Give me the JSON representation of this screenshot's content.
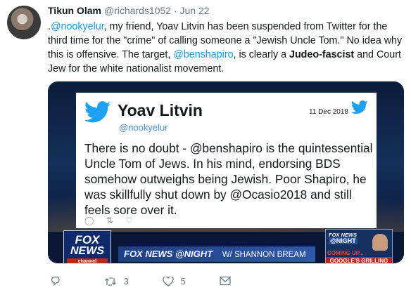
{
  "tweet": {
    "author_name": "Tikun Olam",
    "handle": "@richards1052",
    "separator": "·",
    "date": "Jun 22",
    "text_parts": [
      ".",
      "@nookyelur",
      ", my friend, Yoav Litvin has been suspended from Twitter for the third time for the \"crime\" of calling someone a \"Jewish Uncle Tom.\"  No idea why this is offensive. The target, ",
      "@benshapiro",
      ", is clearly a ",
      "Judeo-fascist",
      " and Court Jew for the white nationalist movement."
    ]
  },
  "quoted": {
    "name": "Yoav Litvin",
    "handle": "@nookyelur",
    "date": "11 Dec 2018",
    "text": "There is no doubt - @benshapiro is the quintessential Uncle Tom of Jews. In his mind, endorsing BDS somehow outweighs being Jewish. Poor Shapiro, he was skillfully shut down by @Ocasio2018 and still feels sore over it."
  },
  "fox": {
    "logo_line1": "FOX",
    "logo_line2": "NEWS",
    "logo_line3": "channel",
    "strip_show": "FOX NEWS @NIGHT",
    "strip_host": "W/ SHANNON BREAM",
    "promo_brand": "FOX NEWS",
    "promo_show": "@NIGHT",
    "promo_coming": "COMING UP...",
    "promo_topic": "GOOGLE'S GRILLING"
  },
  "actions": {
    "retweets": "3",
    "likes": "5"
  },
  "colors": {
    "link": "#1b95e0",
    "twitter_blue": "#1da1f2",
    "secondary_text": "#657786"
  },
  "icons": [
    "reply-icon",
    "retweet-icon",
    "like-icon",
    "message-icon",
    "twitter-bird-icon"
  ]
}
